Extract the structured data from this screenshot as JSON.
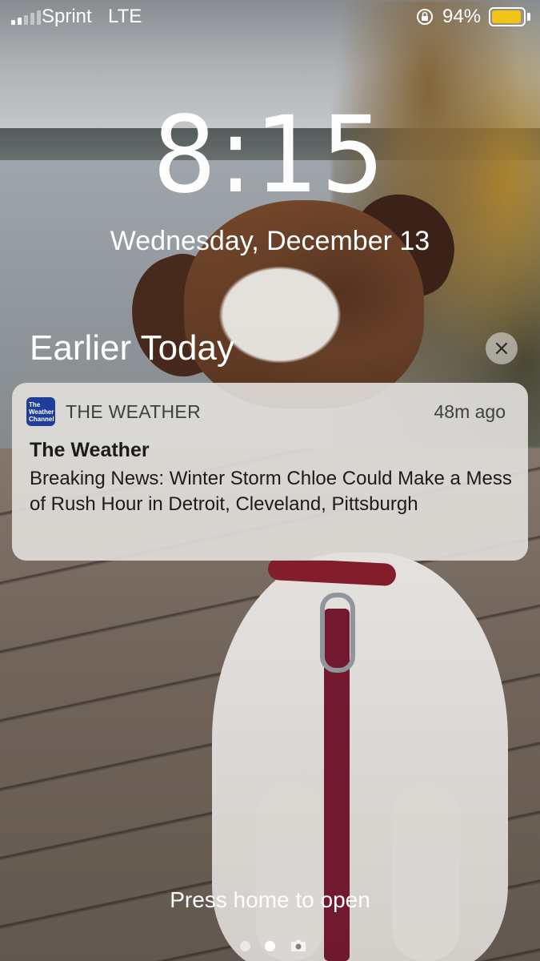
{
  "status_bar": {
    "carrier": "Sprint",
    "network": "LTE",
    "signal_bars_active": 2,
    "signal_bars_total": 5,
    "battery_percent_label": "94%",
    "battery_level": 0.94,
    "battery_color": "#f2c415",
    "rotation_lock_icon": "rotation-lock-icon"
  },
  "lock_screen": {
    "time": "8:15",
    "date": "Wednesday, December 13",
    "section_header": "Earlier Today",
    "clear_icon": "close-icon",
    "press_home_text": "Press home to open",
    "page_indicator": {
      "dots": 2,
      "active_index": 1,
      "camera_icon": "camera-icon"
    }
  },
  "notification": {
    "app_icon_text": "The Weather Channel",
    "app_icon_color": "#1f3d99",
    "app_name": "THE WEATHER",
    "time_ago": "48m ago",
    "title": "The Weather",
    "body": "Breaking News: Winter Storm Chloe Could Make a Mess of Rush Hour in Detroit, Cleveland, Pittsburgh"
  }
}
